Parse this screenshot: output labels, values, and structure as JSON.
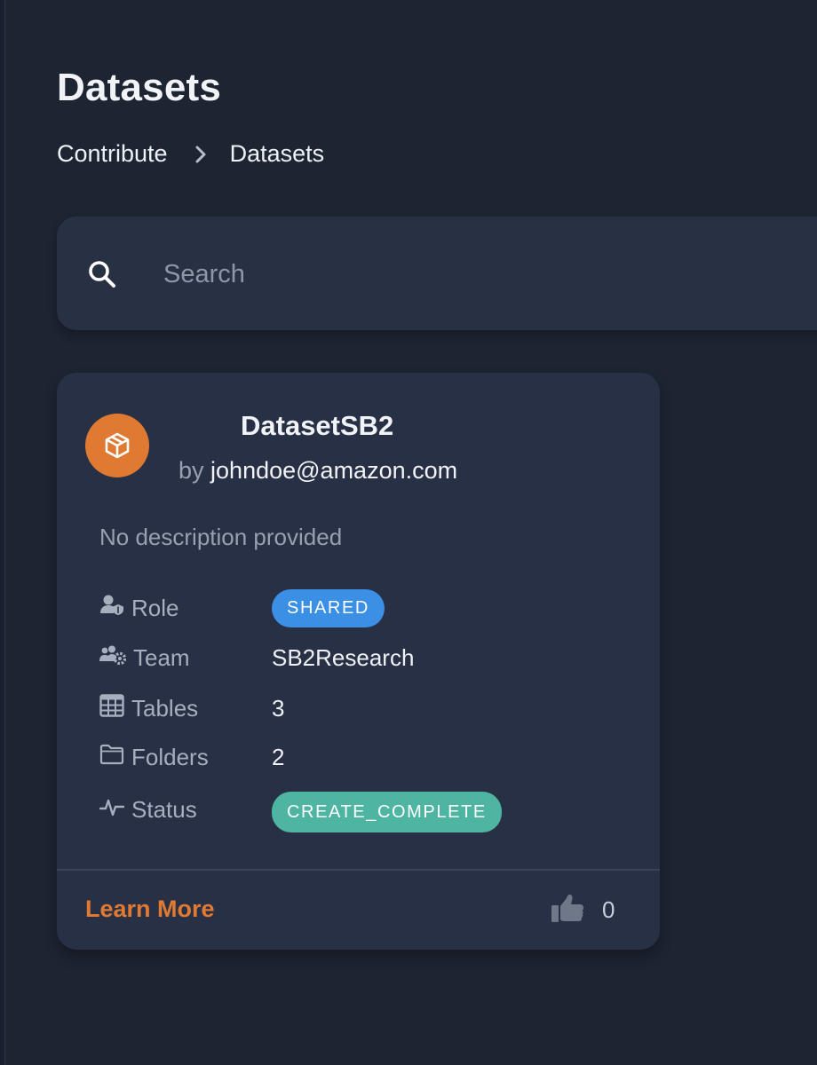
{
  "page": {
    "title": "Datasets"
  },
  "breadcrumb": {
    "items": [
      "Contribute",
      "Datasets"
    ]
  },
  "search": {
    "placeholder": "Search",
    "value": ""
  },
  "card": {
    "title": "DatasetSB2",
    "owner_prefix": "by",
    "owner": "johndoe@amazon.com",
    "description": "No description provided",
    "fields": {
      "role": {
        "label": "Role",
        "value": "SHARED"
      },
      "team": {
        "label": "Team",
        "value": "SB2Research"
      },
      "tables": {
        "label": "Tables",
        "value": "3"
      },
      "folders": {
        "label": "Folders",
        "value": "2"
      },
      "status": {
        "label": "Status",
        "value": "CREATE_COMPLETE"
      }
    },
    "footer": {
      "learn_more": "Learn More",
      "likes": "0"
    }
  },
  "colors": {
    "background": "#1d2432",
    "card": "#273044",
    "accent": "#e07a33",
    "role_badge": "#3b8fe4",
    "status_badge": "#4fb5a3"
  },
  "icons": {
    "search": "search-icon",
    "avatar": "cube-icon",
    "role": "user-shield-icon",
    "team": "users-gear-icon",
    "tables": "table-icon",
    "folders": "folder-icon",
    "status": "activity-icon",
    "like": "thumbs-up-icon",
    "breadcrumb_separator": "chevron-right-icon"
  }
}
